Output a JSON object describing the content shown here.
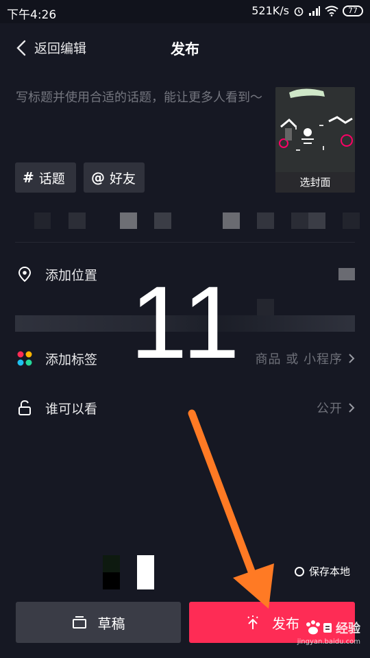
{
  "status_bar": {
    "time": "下午4:26",
    "speed": "521K/s",
    "battery": "77"
  },
  "nav": {
    "back_label": "返回编辑",
    "title": "发布"
  },
  "caption": {
    "placeholder": "写标题并使用合适的话题，能让更多人看到～"
  },
  "cover": {
    "label": "选封面"
  },
  "chips": [
    {
      "symbol": "#",
      "label": "话题"
    },
    {
      "symbol": "@",
      "label": "好友"
    }
  ],
  "rows": {
    "location": {
      "label": "添加位置"
    },
    "tags": {
      "label": "添加标签",
      "value": "商品 或 小程序"
    },
    "visibility": {
      "label": "谁可以看",
      "value": "公开"
    }
  },
  "annotation": {
    "number": "11",
    "arrow_color": "#ff7a24"
  },
  "save_local": {
    "label": "保存本地"
  },
  "buttons": {
    "draft": "草稿",
    "publish": "发布"
  },
  "watermark": {
    "brand": "经验",
    "url": "jingyan.baidu.com"
  },
  "colors": {
    "background": "#161823",
    "accent": "#fe2c55",
    "secondary_button": "#3a3c46"
  }
}
